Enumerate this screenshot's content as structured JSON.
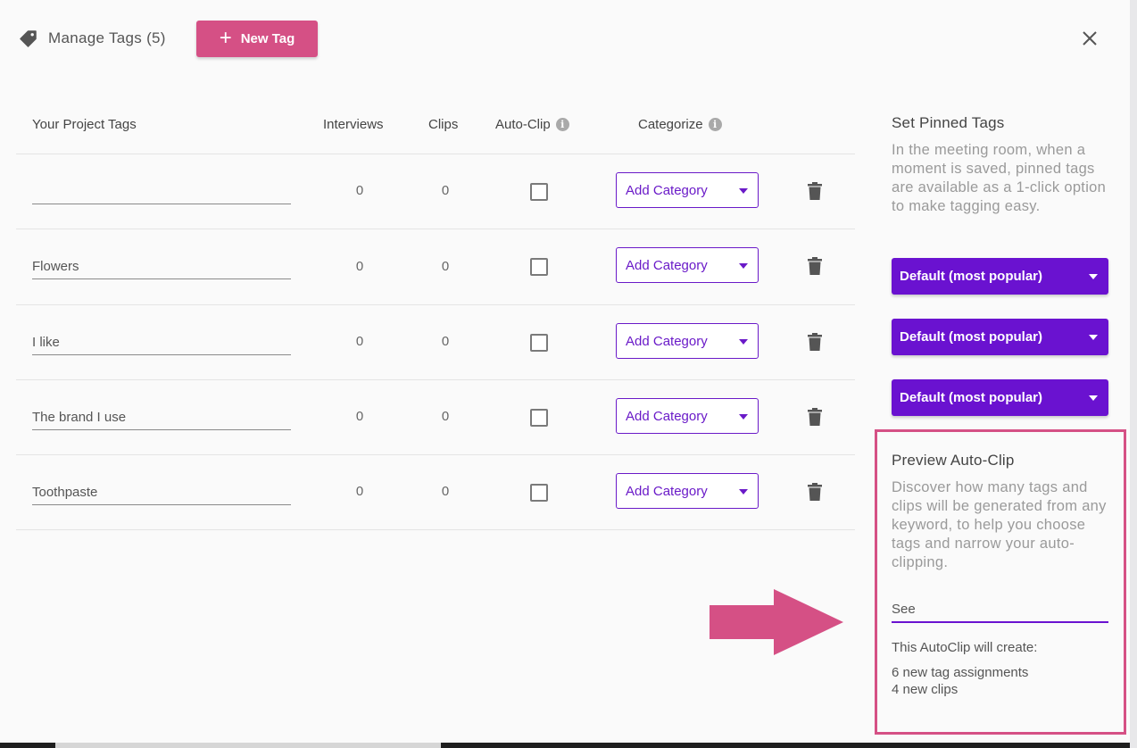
{
  "header": {
    "title": "Manage Tags (5)",
    "new_tag_label": "New Tag",
    "icons": {
      "tag": "tag-icon",
      "close": "close-icon",
      "plus": "plus-icon"
    }
  },
  "table": {
    "columns": {
      "tags": "Your Project Tags",
      "interviews": "Interviews",
      "clips": "Clips",
      "auto_clip": "Auto-Clip",
      "categorize": "Categorize"
    },
    "rows": [
      {
        "tag": "",
        "interviews": "0",
        "clips": "0",
        "auto_clip": false,
        "category": "Add Category"
      },
      {
        "tag": "Flowers",
        "interviews": "0",
        "clips": "0",
        "auto_clip": false,
        "category": "Add Category"
      },
      {
        "tag": "I like",
        "interviews": "0",
        "clips": "0",
        "auto_clip": false,
        "category": "Add Category"
      },
      {
        "tag": "The brand I use",
        "interviews": "0",
        "clips": "0",
        "auto_clip": false,
        "category": "Add Category"
      },
      {
        "tag": "Toothpaste",
        "interviews": "0",
        "clips": "0",
        "auto_clip": false,
        "category": "Add Category"
      }
    ]
  },
  "pinned": {
    "title": "Set Pinned Tags",
    "description": "In the meeting room, when a moment is saved, pinned tags are available as a 1-click option to make tagging easy.",
    "dropdowns": [
      "Default (most popular)",
      "Default (most popular)",
      "Default (most popular)"
    ]
  },
  "preview": {
    "title": "Preview Auto-Clip",
    "description": "Discover how many tags and clips will be generated from any keyword, to help you choose tags and narrow your auto-clipping.",
    "keyword_value": "See",
    "result_label": "This AutoClip will create:",
    "result_tags": "6 new tag assignments",
    "result_clips": "4 new clips"
  },
  "colors": {
    "brand_pink": "#d55085",
    "accent_purple": "#6a12d0"
  }
}
